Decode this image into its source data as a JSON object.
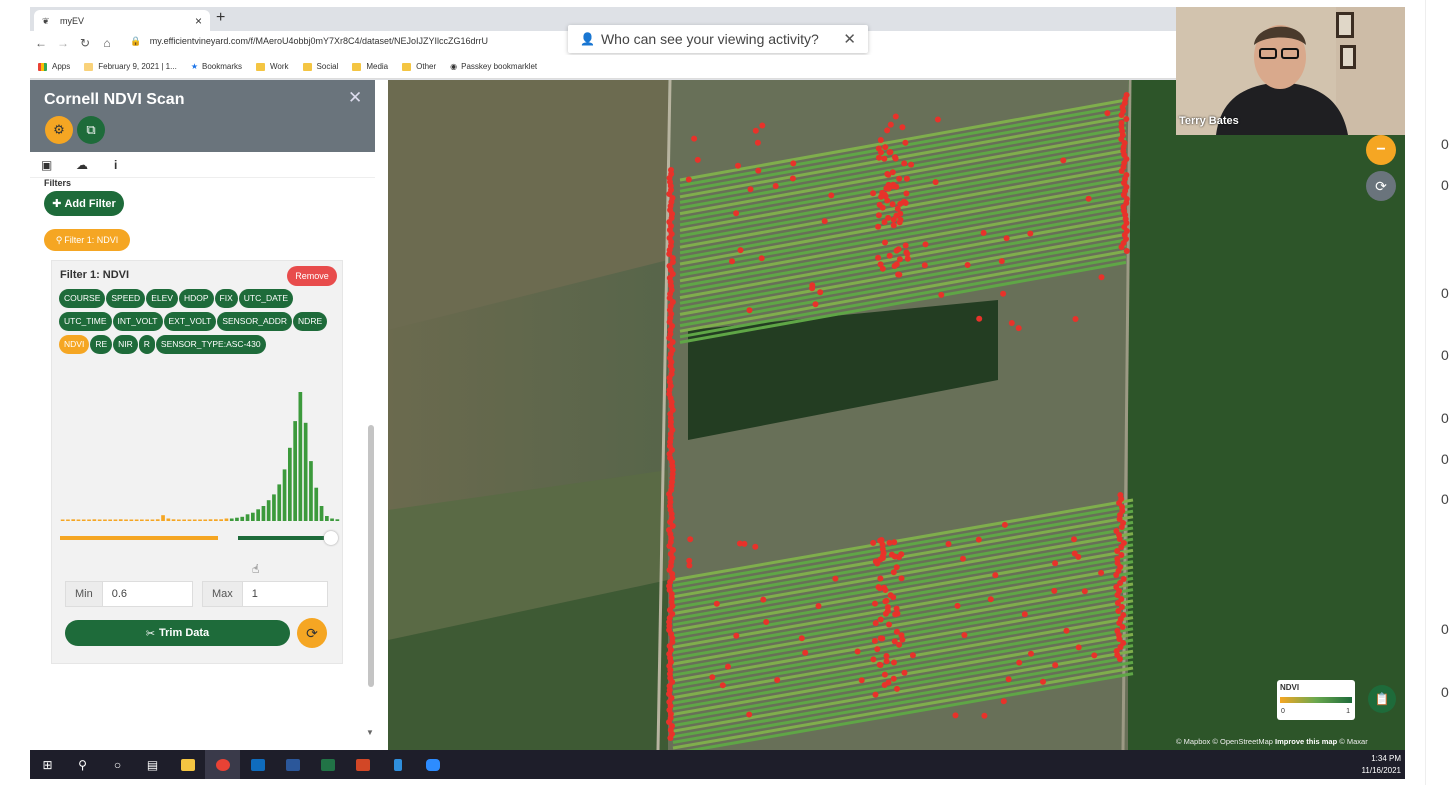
{
  "browser": {
    "tab_title": "myEV",
    "url": "my.efficientvineyard.com/f/MAeroU4obbj0mY7Xr8C4/dataset/NEJoIJZYIlccZG16drrU",
    "popup_text": "Who can see your viewing activity?"
  },
  "bookmarks": [
    "Apps",
    "February 9, 2021 | 1...",
    "Bookmarks",
    "Work",
    "Social",
    "Media",
    "Other",
    "Passkey bookmarklet"
  ],
  "panel": {
    "title": "Cornell NDVI Scan",
    "filters_label": "Filters",
    "add_filter_label": "Add Filter",
    "filter_chip_label": "Filter 1: NDVI",
    "filter": {
      "title": "Filter 1: NDVI",
      "remove_label": "Remove",
      "attributes": [
        "COURSE",
        "SPEED",
        "ELEV",
        "HDOP",
        "FIX",
        "UTC_DATE",
        "UTC_TIME",
        "INT_VOLT",
        "EXT_VOLT",
        "SENSOR_ADDR",
        "NDRE",
        "NDVI",
        "RE",
        "NIR",
        "R",
        "SENSOR_TYPE:ASC-430"
      ],
      "active_attribute": "NDVI",
      "min_label": "Min",
      "min_value": "0.6",
      "max_label": "Max",
      "max_value": "1",
      "trim_label": "Trim Data",
      "histogram_bins": [
        1,
        1,
        2,
        1,
        1,
        1,
        2,
        1,
        1,
        1,
        1,
        2,
        1,
        1,
        1,
        1,
        1,
        1,
        2,
        7,
        3,
        2,
        1,
        1,
        1,
        1,
        1,
        1,
        2,
        2,
        2,
        3,
        3,
        4,
        5,
        8,
        10,
        14,
        18,
        25,
        32,
        44,
        62,
        88,
        120,
        155,
        118,
        72,
        40,
        18,
        6,
        3,
        2
      ],
      "histogram_max": 155,
      "range_min_fraction": 0.6,
      "range_max_fraction": 1.0
    }
  },
  "map": {
    "legend_title": "NDVI",
    "legend_min": "0",
    "legend_max": "1",
    "attr_mapbox": "© Mapbox",
    "attr_osm": "© OpenStreetMap",
    "attr_improve": "Improve this map",
    "attr_maxar": "© Maxar"
  },
  "webcam": {
    "name": "Terry Bates"
  },
  "taskbar": {
    "time": "1:34 PM",
    "date": "11/16/2021"
  },
  "rightstrip": [
    "0",
    "0",
    "0",
    "0",
    "0",
    "0",
    "0",
    "0",
    "0"
  ],
  "colors": {
    "green": "#1e6b3a",
    "orange": "#f5a623",
    "red": "#e8322a",
    "panel_header": "#6a747c"
  }
}
